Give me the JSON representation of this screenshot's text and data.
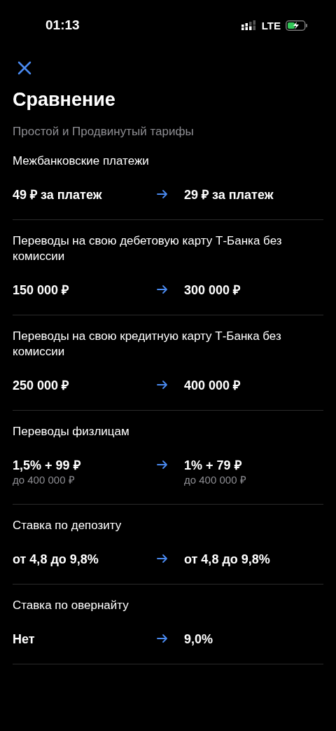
{
  "status_bar": {
    "time": "01:13",
    "network": "LTE"
  },
  "title": "Сравнение",
  "subtitle": "Простой и Продвинутый тарифы",
  "rows": [
    {
      "title": "Межбанковские платежи",
      "from": {
        "value": "49 ₽ за платеж"
      },
      "to": {
        "value": "29 ₽ за платеж"
      }
    },
    {
      "title": "Переводы на свою дебетовую карту Т-Банка без комиссии",
      "from": {
        "value": "150 000 ₽"
      },
      "to": {
        "value": "300 000 ₽"
      }
    },
    {
      "title": "Переводы на свою кредитную карту Т-Банка без комиссии",
      "from": {
        "value": "250 000 ₽"
      },
      "to": {
        "value": "400 000 ₽"
      }
    },
    {
      "title": "Переводы физлицам",
      "from": {
        "value": "1,5% + 99 ₽",
        "note": "до 400 000 ₽"
      },
      "to": {
        "value": "1% + 79 ₽",
        "note": "до 400 000 ₽"
      }
    },
    {
      "title": "Ставка по депозиту",
      "from": {
        "value": "от 4,8 до 9,8%"
      },
      "to": {
        "value": "от 4,8 до 9,8%"
      }
    },
    {
      "title": "Ставка по овернайту",
      "from": {
        "value": "Нет"
      },
      "to": {
        "value": "9,0%"
      }
    }
  ]
}
